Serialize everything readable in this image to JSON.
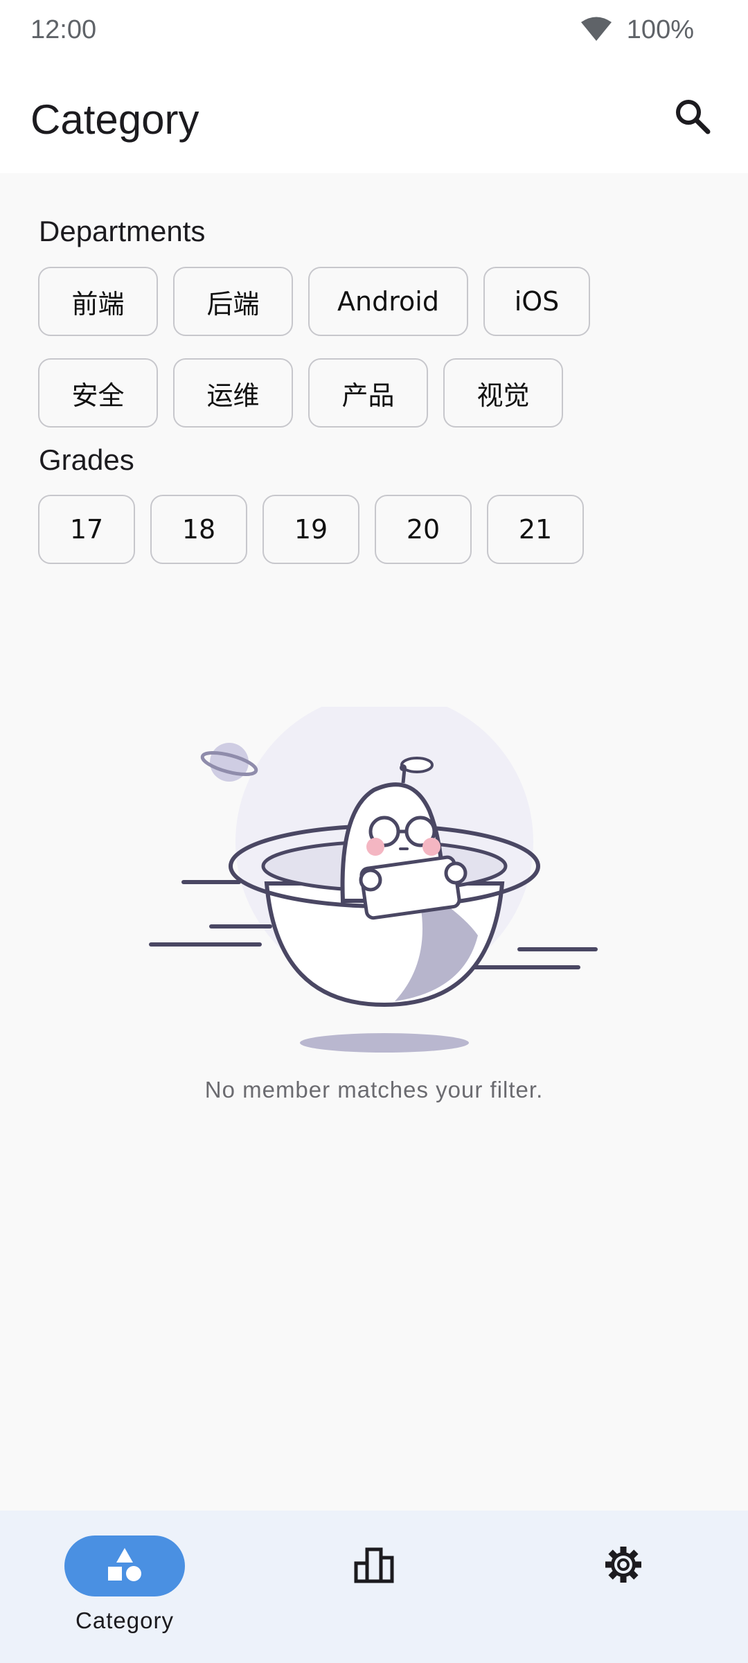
{
  "status_bar": {
    "time": "12:00",
    "battery": "100%"
  },
  "app_bar": {
    "title": "Category"
  },
  "departments": {
    "title": "Departments",
    "chips": [
      "前端",
      "后端",
      "Android",
      "iOS",
      "安全",
      "运维",
      "产品",
      "视觉"
    ]
  },
  "grades": {
    "title": "Grades",
    "chips": [
      "17",
      "18",
      "19",
      "20",
      "21"
    ]
  },
  "empty_state": {
    "message": "No member matches your filter."
  },
  "bottom_nav": {
    "items": [
      {
        "label": "Category",
        "icon": "category-shapes-icon",
        "active": true
      },
      {
        "label": "",
        "icon": "leaderboard-icon",
        "active": false
      },
      {
        "label": "",
        "icon": "gear-icon",
        "active": false
      }
    ]
  },
  "colors": {
    "accent": "#4a90e2",
    "nav_background": "#edf2fa",
    "chip_border": "#c7c7cc"
  }
}
